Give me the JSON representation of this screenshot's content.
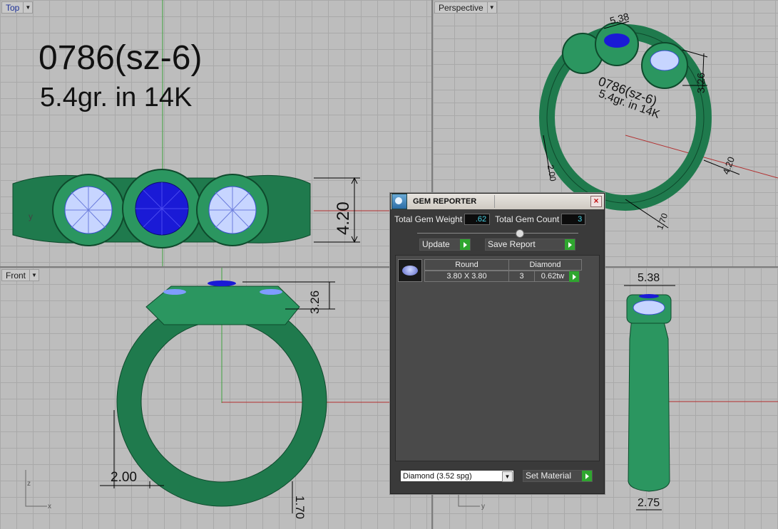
{
  "viewports": {
    "top": {
      "label": "Top"
    },
    "perspective": {
      "label": "Perspective"
    },
    "front": {
      "label": "Front"
    }
  },
  "notes": {
    "line1": "0786(sz-6)",
    "line2": "5.4gr.  in 14K"
  },
  "dimensions": {
    "top_height": "4.20",
    "persp_top": "5.38",
    "persp_side": "3.26",
    "persp_band": "4.20",
    "persp_shank": "2.00",
    "persp_bottom": "1.70",
    "front_height": "3.26",
    "front_shank": "2.00",
    "front_bottom": "1.70",
    "right_top": "5.38",
    "right_bottom": "2.75"
  },
  "axis": {
    "z": "z",
    "x": "x",
    "y": "y"
  },
  "gem_reporter": {
    "title": "GEM REPORTER",
    "close": "×",
    "total_weight_label": "Total Gem Weight",
    "total_weight_value": ".62",
    "total_count_label": "Total Gem Count",
    "total_count_value": "3",
    "update_label": "Update",
    "save_report_label": "Save Report",
    "table": {
      "col_shape": "Round",
      "col_type": "Diamond",
      "size": "3.80 X 3.80",
      "count": "3",
      "weight": "0.62tw"
    },
    "material_select": "Diamond    (3.52 spg)",
    "set_material_label": "Set Material"
  },
  "colors": {
    "ring": "#2e8a5c",
    "blue_gem": "#1414c8",
    "diamond": "#b6c8ff"
  }
}
